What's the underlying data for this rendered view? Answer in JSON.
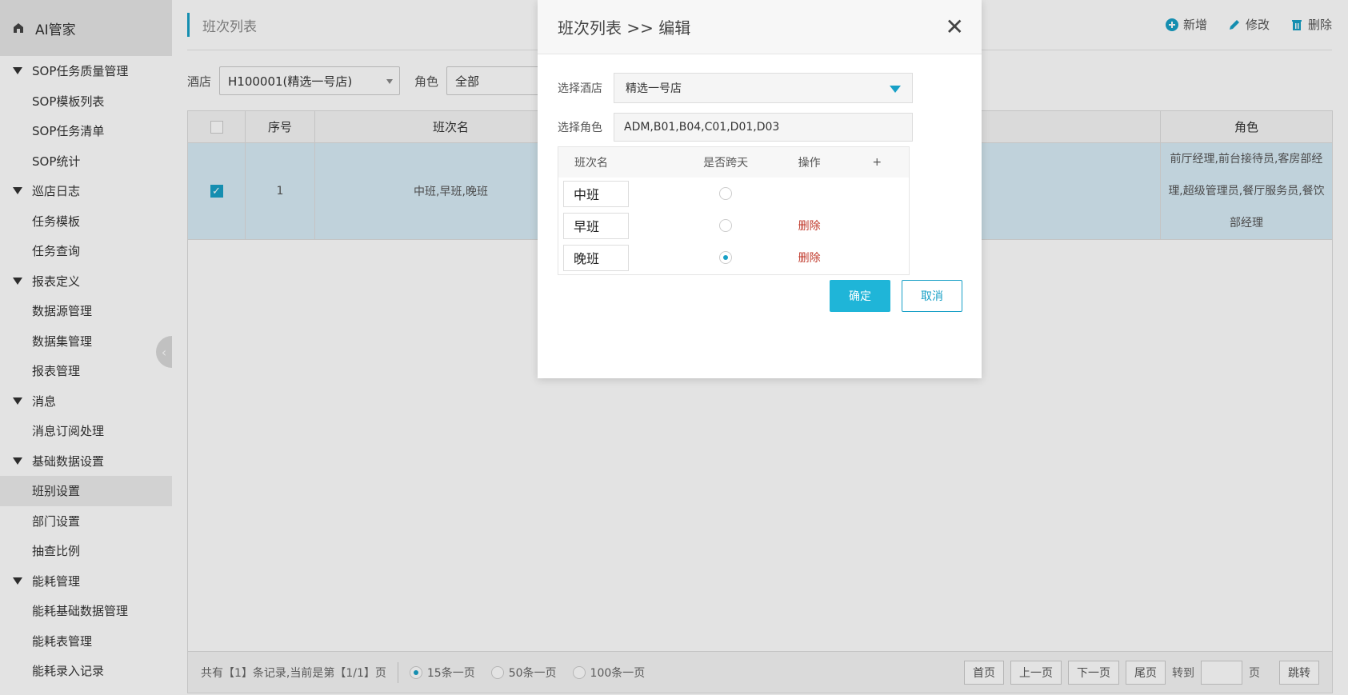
{
  "app": {
    "title": "AI管家"
  },
  "sidebar": {
    "groups": [
      {
        "label": "SOP任务质量管理",
        "items": [
          "SOP模板列表",
          "SOP任务清单",
          "SOP统计"
        ]
      },
      {
        "label": "巡店日志",
        "items": [
          "任务模板",
          "任务查询"
        ]
      },
      {
        "label": "报表定义",
        "items": [
          "数据源管理",
          "数据集管理",
          "报表管理"
        ]
      },
      {
        "label": "消息",
        "items": [
          "消息订阅处理"
        ]
      },
      {
        "label": "基础数据设置",
        "items": [
          "班别设置",
          "部门设置",
          "抽查比例"
        ]
      },
      {
        "label": "能耗管理",
        "items": [
          "能耗基础数据管理",
          "能耗表管理",
          "能耗录入记录"
        ]
      }
    ],
    "active_item": "班别设置"
  },
  "page": {
    "title": "班次列表",
    "actions": {
      "add": "新增",
      "edit": "修改",
      "delete": "删除"
    },
    "filter": {
      "hotel_label": "酒店",
      "hotel_value": "H100001(精选一号店)",
      "role_label": "角色",
      "role_value": "全部"
    },
    "table": {
      "headers": {
        "no": "序号",
        "name": "班次名",
        "role": "角色"
      },
      "rows": [
        {
          "no": "1",
          "name": "中班,早班,晚班",
          "role_lines": [
            "前厅经理,前台接待员,客房部经",
            "理,超级管理员,餐厅服务员,餐饮",
            "部经理"
          ]
        }
      ]
    },
    "pager": {
      "summary": "共有【1】条记录,当前是第【1/1】页",
      "sizes": [
        "15条一页",
        "50条一页",
        "100条一页"
      ],
      "first": "首页",
      "prev": "上一页",
      "next": "下一页",
      "last": "尾页",
      "goto_label": "转到",
      "page_label": "页",
      "jump": "跳转"
    }
  },
  "modal": {
    "title": "班次列表 >> 编辑",
    "close": "✕",
    "hotel_label": "选择酒店",
    "hotel_value": "精选一号店",
    "role_label": "选择角色",
    "role_value": "ADM,B01,B04,C01,D01,D03",
    "shift_table": {
      "headers": {
        "name": "班次名",
        "cross_day": "是否跨天",
        "action": "操作",
        "add": "+"
      },
      "rows": [
        {
          "name": "中班",
          "cross_day": false,
          "action": ""
        },
        {
          "name": "早班",
          "cross_day": false,
          "action": "删除"
        },
        {
          "name": "晚班",
          "cross_day": true,
          "action": "删除"
        }
      ]
    },
    "ok": "确定",
    "cancel": "取消"
  },
  "colors": {
    "accent": "#1fb5d8",
    "danger": "#c0392b",
    "row_selected": "#d8ecf7"
  }
}
